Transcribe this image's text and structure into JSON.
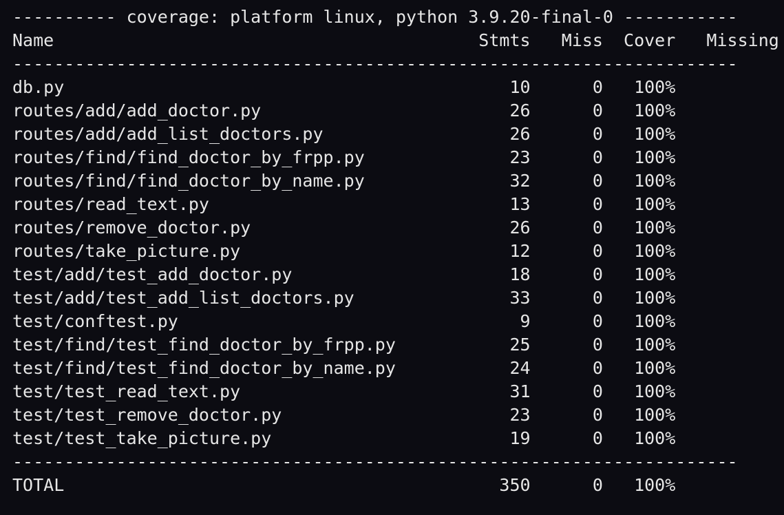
{
  "terminal": {
    "header_line": "---------- coverage: platform linux, python 3.9.20-final-0 -----------",
    "column_header_line": "Name                                         Stmts   Miss  Cover   Missing",
    "separator_line": "----------------------------------------------------------------------",
    "rows": [
      "db.py                                           10      0   100%",
      "routes/add/add_doctor.py                        26      0   100%",
      "routes/add/add_list_doctors.py                  26      0   100%",
      "routes/find/find_doctor_by_frpp.py              23      0   100%",
      "routes/find/find_doctor_by_name.py              32      0   100%",
      "routes/read_text.py                             13      0   100%",
      "routes/remove_doctor.py                         26      0   100%",
      "routes/take_picture.py                          12      0   100%",
      "test/add/test_add_doctor.py                     18      0   100%",
      "test/add/test_add_list_doctors.py               33      0   100%",
      "test/conftest.py                                 9      0   100%",
      "test/find/test_find_doctor_by_frpp.py           25      0   100%",
      "test/find/test_find_doctor_by_name.py           24      0   100%",
      "test/test_read_text.py                          31      0   100%",
      "test/test_remove_doctor.py                      23      0   100%",
      "test/test_take_picture.py                       19      0   100%"
    ],
    "total_line": "TOTAL                                          350      0   100%",
    "colors": {
      "background": "#0c0c12",
      "foreground": "#e6e6e6"
    }
  }
}
